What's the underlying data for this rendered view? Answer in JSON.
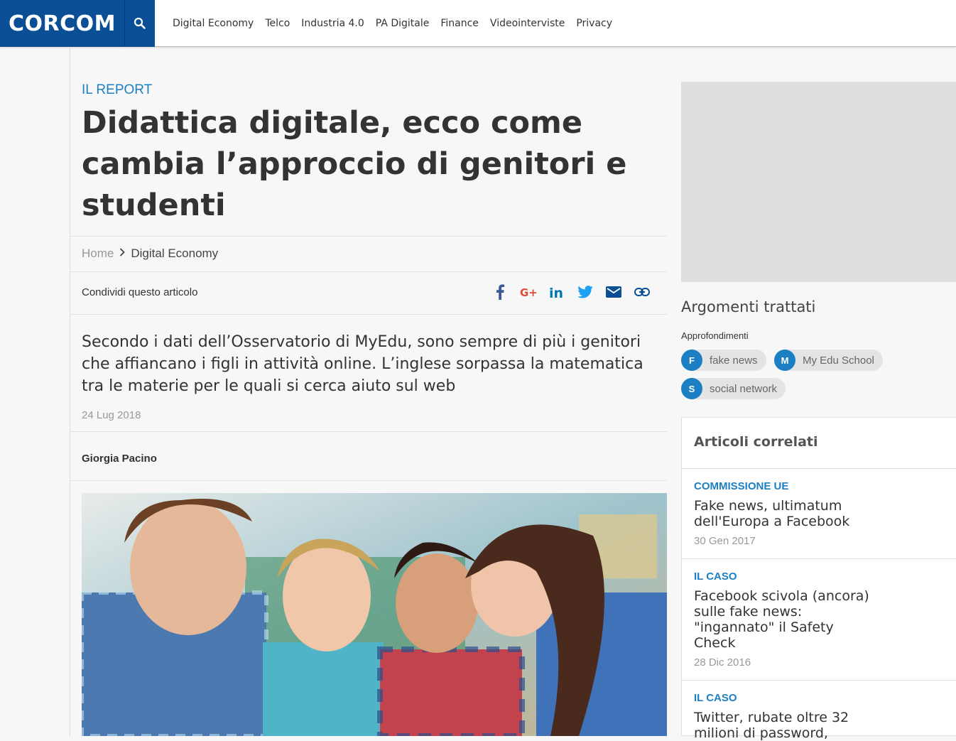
{
  "header": {
    "logo": "CORCOM",
    "nav": [
      "Digital Economy",
      "Telco",
      "Industria 4.0",
      "PA Digitale",
      "Finance",
      "Videointerviste",
      "Privacy"
    ]
  },
  "article": {
    "kicker": "IL REPORT",
    "title": "Didattica digitale, ecco come cambia l’approccio di genitori e studenti",
    "breadcrumb": {
      "home": "Home",
      "current": "Digital Economy"
    },
    "share_label": "Condividi questo articolo",
    "lead": "Secondo i dati dell’Osservatorio di MyEdu, sono sempre di più i genitori che affiancano i figli in attività online. L’inglese sorpassa la matematica tra le materie per le quali si cerca aiuto sul web",
    "date": "24 Lug 2018",
    "author": "Giorgia Pacino"
  },
  "sidebar": {
    "topics_title": "Argomenti trattati",
    "topics_sub": "Approfondimenti",
    "tags": [
      {
        "letter": "F",
        "label": "fake news"
      },
      {
        "letter": "M",
        "label": "My Edu School"
      },
      {
        "letter": "S",
        "label": "social network"
      }
    ],
    "related_title": "Articoli correlati",
    "related": [
      {
        "kicker": "COMMISSIONE UE",
        "title": "Fake news, ultimatum dell'Europa a Facebook",
        "date": "30 Gen 2017"
      },
      {
        "kicker": "IL CASO",
        "title": "Facebook scivola (ancora) sulle fake news: \"ingannato\" il Safety Check",
        "date": "28 Dic 2016"
      },
      {
        "kicker": "IL CASO",
        "title": "Twitter, rubate oltre 32 milioni di password,",
        "date": ""
      }
    ]
  },
  "colors": {
    "brand": "#0a4f96",
    "accent": "#1d7fc3"
  }
}
